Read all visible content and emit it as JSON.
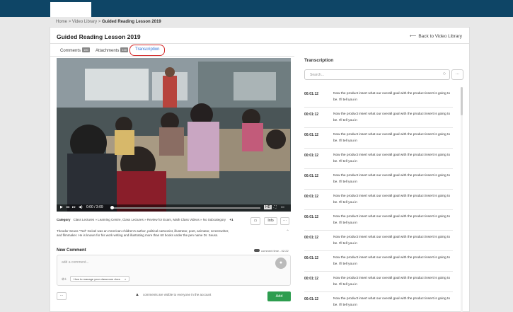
{
  "breadcrumb": {
    "home": "Home",
    "sep": ">",
    "library": "Video Library",
    "current": "Guided Reading Lesson 2019"
  },
  "header": {
    "title": "Guided Reading Lesson 2019",
    "back": "Back to Video Library"
  },
  "tabs": [
    {
      "label": "Comments",
      "count": "100"
    },
    {
      "label": "Attachments",
      "count": "100"
    },
    {
      "label": "Transcription"
    }
  ],
  "player": {
    "time": "0:00 / 3:09",
    "quality": "HD"
  },
  "category": {
    "label": "Category",
    "path": "Class Lectures » Learning Centre, Class Lectures » Review for Exam, Math Class Videos » No Subcategory",
    "more": "+1",
    "info_label": "Info",
    "more_label": "···"
  },
  "description": "Theodor Seuss \"Ted\" Geisel was an American children's author, political cartoonist, illustrator, poet, animator, screenwriter, and filmmaker. He is known for his work writing and illustrating more than 60 books under the pen name Dr. Seuss.",
  "comment": {
    "heading": "New Comment",
    "time_label": "comment time - 02:22",
    "placeholder": "add a comment...",
    "chip": "How to manage your classroom docs",
    "chip_close": "×",
    "notice": "comments are visible to everyone in the account",
    "add": "Add",
    "more": "···"
  },
  "transcript": {
    "title": "Transcription",
    "search_placeholder": "Search...",
    "more": "···",
    "rows": [
      {
        "time": "00:01:12",
        "text": "Now the product insert what our overall goal with the product insert is going to be. I'll tell you in"
      },
      {
        "time": "00:01:12",
        "text": "Now the product insert what our overall goal with the product insert is going to be. I'll tell you in"
      },
      {
        "time": "00:01:12",
        "text": "Now the product insert what our overall goal with the product insert is going to be. I'll tell you in"
      },
      {
        "time": "00:01:12",
        "text": "Now the product insert what our overall goal with the product insert is going to be. I'll tell you in"
      },
      {
        "time": "00:01:12",
        "text": "Now the product insert what our overall goal with the product insert is going to be. I'll tell you in"
      },
      {
        "time": "00:01:12",
        "text": "Now the product insert what our overall goal with the product insert is going to be. I'll tell you in"
      },
      {
        "time": "00:01:12",
        "text": "Now the product insert what our overall goal with the product insert is going to be. I'll tell you in"
      },
      {
        "time": "00:01:12",
        "text": "Now the product insert what our overall goal with the product insert is going to be. I'll tell you in"
      },
      {
        "time": "00:01:12",
        "text": "Now the product insert what our overall goal with the product insert is going to be. I'll tell you in"
      },
      {
        "time": "00:01:12",
        "text": "Now the product insert what our overall goal with the product insert is going to be. I'll tell you in"
      },
      {
        "time": "00:01:12",
        "text": "Now the product insert what our overall goal with the product insert is going to be. I'll tell you in"
      }
    ]
  }
}
